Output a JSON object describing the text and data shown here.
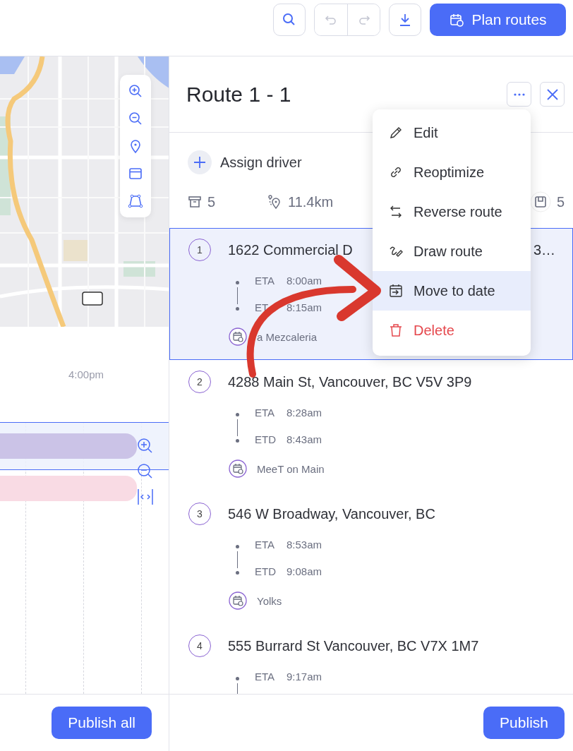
{
  "toolbar": {
    "plan_button": "Plan routes"
  },
  "timeline": {
    "time_label": "4:00pm",
    "lanes": [
      {
        "color": "#cbc3e7",
        "selected": true
      },
      {
        "color": "#f9dbe4",
        "selected": false
      }
    ]
  },
  "publish_all": "Publish all",
  "route": {
    "title": "Route 1 - 1",
    "assign_driver": "Assign driver",
    "stats": [
      {
        "kind": "stops",
        "value": "5"
      },
      {
        "kind": "distance",
        "value": "11.4km"
      },
      {
        "kind": "capacity",
        "value": "5"
      }
    ],
    "stops": [
      {
        "number": "1",
        "address": "1622 Commercial D",
        "address_tail": "3…",
        "times": [
          {
            "label": "ETA",
            "time": "8:00am"
          },
          {
            "label": "ET",
            "time": "8:15am"
          }
        ],
        "place": "a Mezcaleria",
        "selected": true
      },
      {
        "number": "2",
        "address": "4288 Main St, Vancouver, BC V5V 3P9",
        "times": [
          {
            "label": "ETA",
            "time": "8:28am"
          },
          {
            "label": "ETD",
            "time": "8:43am"
          }
        ],
        "place": "MeeT on Main",
        "selected": false
      },
      {
        "number": "3",
        "address": "546 W Broadway, Vancouver, BC",
        "times": [
          {
            "label": "ETA",
            "time": "8:53am"
          },
          {
            "label": "ETD",
            "time": "9:08am"
          }
        ],
        "place": "Yolks",
        "selected": false
      },
      {
        "number": "4",
        "address": "555 Burrard St Vancouver, BC V7X 1M7",
        "times": [
          {
            "label": "ETA",
            "time": "9:17am"
          }
        ],
        "selected": false
      }
    ],
    "publish": "Publish"
  },
  "menu": {
    "items": [
      {
        "kind": "edit",
        "label": "Edit",
        "selected": false
      },
      {
        "kind": "reoptimize",
        "label": "Reoptimize",
        "selected": false
      },
      {
        "kind": "reverse",
        "label": "Reverse route",
        "selected": false
      },
      {
        "kind": "draw",
        "label": "Draw route",
        "selected": false
      },
      {
        "kind": "move",
        "label": "Move to date",
        "selected": true
      },
      {
        "kind": "delete",
        "label": "Delete",
        "selected": false
      }
    ]
  }
}
